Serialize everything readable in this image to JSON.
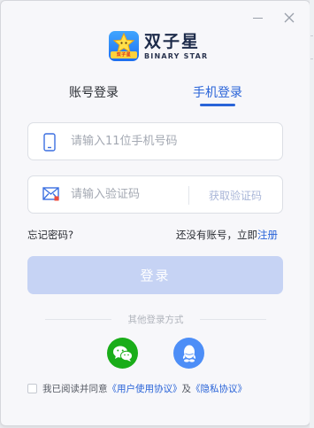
{
  "app": {
    "title": "双子星",
    "subtitle": "BINARY STAR",
    "badge_text": "双子星"
  },
  "tabs": [
    {
      "label": "账号登录",
      "active": false
    },
    {
      "label": "手机登录",
      "active": true
    }
  ],
  "phone_field": {
    "placeholder": "请输入11位手机号码",
    "value": ""
  },
  "code_field": {
    "placeholder": "请输入验证码",
    "value": "",
    "get_code_label": "获取验证码"
  },
  "links": {
    "forgot": "忘记密码?",
    "no_account": "还没有账号，立即",
    "register": "注册"
  },
  "login_button": "登录",
  "other_login_label": "其他登录方式",
  "social": [
    {
      "name": "wechat",
      "icon": "wechat-icon"
    },
    {
      "name": "qq",
      "icon": "qq-icon"
    }
  ],
  "agreement": {
    "prefix": "我已阅读并同意",
    "user_agreement": "《用户使用协议》",
    "and": "及",
    "privacy": "《隐私协议》",
    "checked": false
  },
  "colors": {
    "accent": "#2a64d8",
    "login_disabled": "#c6d3f4",
    "wechat": "#1aad19",
    "qq": "#4d8ef7"
  }
}
